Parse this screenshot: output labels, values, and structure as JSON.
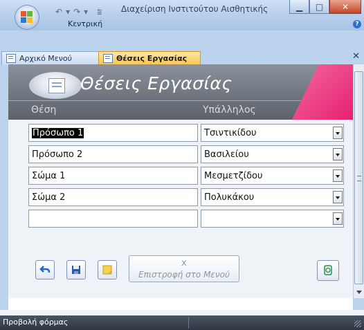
{
  "window": {
    "title": "Διαχείριση Ινστιτούτου Αισθητικής",
    "ribbon_tab": "Κεντρική",
    "help": "?"
  },
  "tabs": [
    {
      "label": "Αρχικό Μενού"
    },
    {
      "label": "Θέσεις Εργασίας",
      "active": true
    }
  ],
  "form": {
    "title": "Θέσεις Εργασίας",
    "columns": {
      "position": "Θέση",
      "employee": "Υπάλληλος"
    },
    "rows": [
      {
        "position": "Πρόσωπο 1",
        "employee": "Τσιντικίδου"
      },
      {
        "position": "Πρόσωπο 2",
        "employee": "Βασιλείου"
      },
      {
        "position": "Σώμα 1",
        "employee": "Μεσμετζίδου"
      },
      {
        "position": "Σώμα 2",
        "employee": "Πολυκάκου"
      },
      {
        "position": "",
        "employee": ""
      }
    ],
    "buttons": {
      "back_symbol": "x",
      "back_label": "Επιστροφή στο Μενού"
    }
  },
  "status": {
    "view": "Προβολή φόρμας"
  },
  "colors": {
    "accent_pink": "#e3176a",
    "header_gray": "#6f767f",
    "active_tab": "#f9c450"
  }
}
